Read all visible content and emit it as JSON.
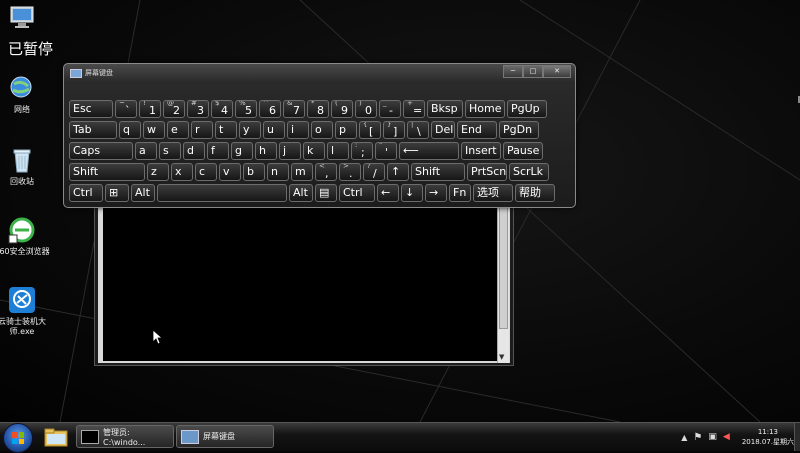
{
  "desktop": {
    "status_text": "已暂停",
    "icons": [
      {
        "label": "",
        "icon": "computer-icon"
      },
      {
        "label": "网络",
        "icon": "network-icon"
      },
      {
        "label": "回收站",
        "icon": "recycle-bin-icon"
      },
      {
        "label": "360安全浏览器",
        "icon": "browser-360-icon"
      },
      {
        "label": "云骑士装机大师.exe",
        "icon": "yunqishi-installer-icon"
      }
    ]
  },
  "osk": {
    "title": "屏幕键盘",
    "window_buttons": {
      "minimize": "─",
      "maximize": "□",
      "close": "✕"
    },
    "rows": [
      [
        {
          "label": "Esc"
        },
        {
          "top": "~",
          "main": "`"
        },
        {
          "top": "!",
          "main": "1"
        },
        {
          "top": "@",
          "main": "2"
        },
        {
          "top": "#",
          "main": "3"
        },
        {
          "top": "$",
          "main": "4"
        },
        {
          "top": "%",
          "main": "5"
        },
        {
          "top": "^",
          "main": "6"
        },
        {
          "top": "&",
          "main": "7"
        },
        {
          "top": "*",
          "main": "8"
        },
        {
          "top": "(",
          "main": "9"
        },
        {
          "top": ")",
          "main": "0"
        },
        {
          "top": "_",
          "main": "-"
        },
        {
          "top": "+",
          "main": "="
        },
        {
          "label": "Bksp"
        },
        {
          "label": "Home"
        },
        {
          "label": "PgUp"
        }
      ],
      [
        {
          "label": "Tab"
        },
        {
          "label": "q"
        },
        {
          "label": "w"
        },
        {
          "label": "e"
        },
        {
          "label": "r"
        },
        {
          "label": "t"
        },
        {
          "label": "y"
        },
        {
          "label": "u"
        },
        {
          "label": "i"
        },
        {
          "label": "o"
        },
        {
          "label": "p"
        },
        {
          "top": "{",
          "main": "["
        },
        {
          "top": "}",
          "main": "]"
        },
        {
          "top": "|",
          "main": "\\"
        },
        {
          "label": "Del"
        },
        {
          "label": "End"
        },
        {
          "label": "PgDn"
        }
      ],
      [
        {
          "label": "Caps"
        },
        {
          "label": "a"
        },
        {
          "label": "s"
        },
        {
          "label": "d"
        },
        {
          "label": "f"
        },
        {
          "label": "g"
        },
        {
          "label": "h"
        },
        {
          "label": "j"
        },
        {
          "label": "k"
        },
        {
          "label": "l"
        },
        {
          "top": ":",
          "main": ";"
        },
        {
          "top": "\"",
          "main": "'"
        },
        {
          "label": "⟵"
        },
        {
          "label": "Insert"
        },
        {
          "label": "Pause"
        }
      ],
      [
        {
          "label": "Shift"
        },
        {
          "label": "z"
        },
        {
          "label": "x"
        },
        {
          "label": "c"
        },
        {
          "label": "v"
        },
        {
          "label": "b"
        },
        {
          "label": "n"
        },
        {
          "label": "m"
        },
        {
          "top": "<",
          "main": ","
        },
        {
          "top": ">",
          "main": "."
        },
        {
          "top": "?",
          "main": "/"
        },
        {
          "label": "↑"
        },
        {
          "label": "Shift"
        },
        {
          "label": "PrtScn"
        },
        {
          "label": "ScrLk"
        }
      ],
      [
        {
          "label": "Ctrl"
        },
        {
          "label": "⊞"
        },
        {
          "label": "Alt"
        },
        {
          "label": ""
        },
        {
          "label": "Alt"
        },
        {
          "label": "▤"
        },
        {
          "label": "Ctrl"
        },
        {
          "label": "←"
        },
        {
          "label": "↓"
        },
        {
          "label": "→"
        },
        {
          "label": "Fn"
        },
        {
          "label": "选项"
        },
        {
          "label": "帮助"
        }
      ]
    ]
  },
  "taskbar": {
    "items": [
      {
        "label": "管理员: C:\\windo...",
        "icon": "console-icon"
      },
      {
        "label": "屏幕键盘",
        "icon": "keyboard-icon"
      }
    ],
    "clock": {
      "time": "11:13",
      "date": "2018.07.星期六"
    }
  }
}
